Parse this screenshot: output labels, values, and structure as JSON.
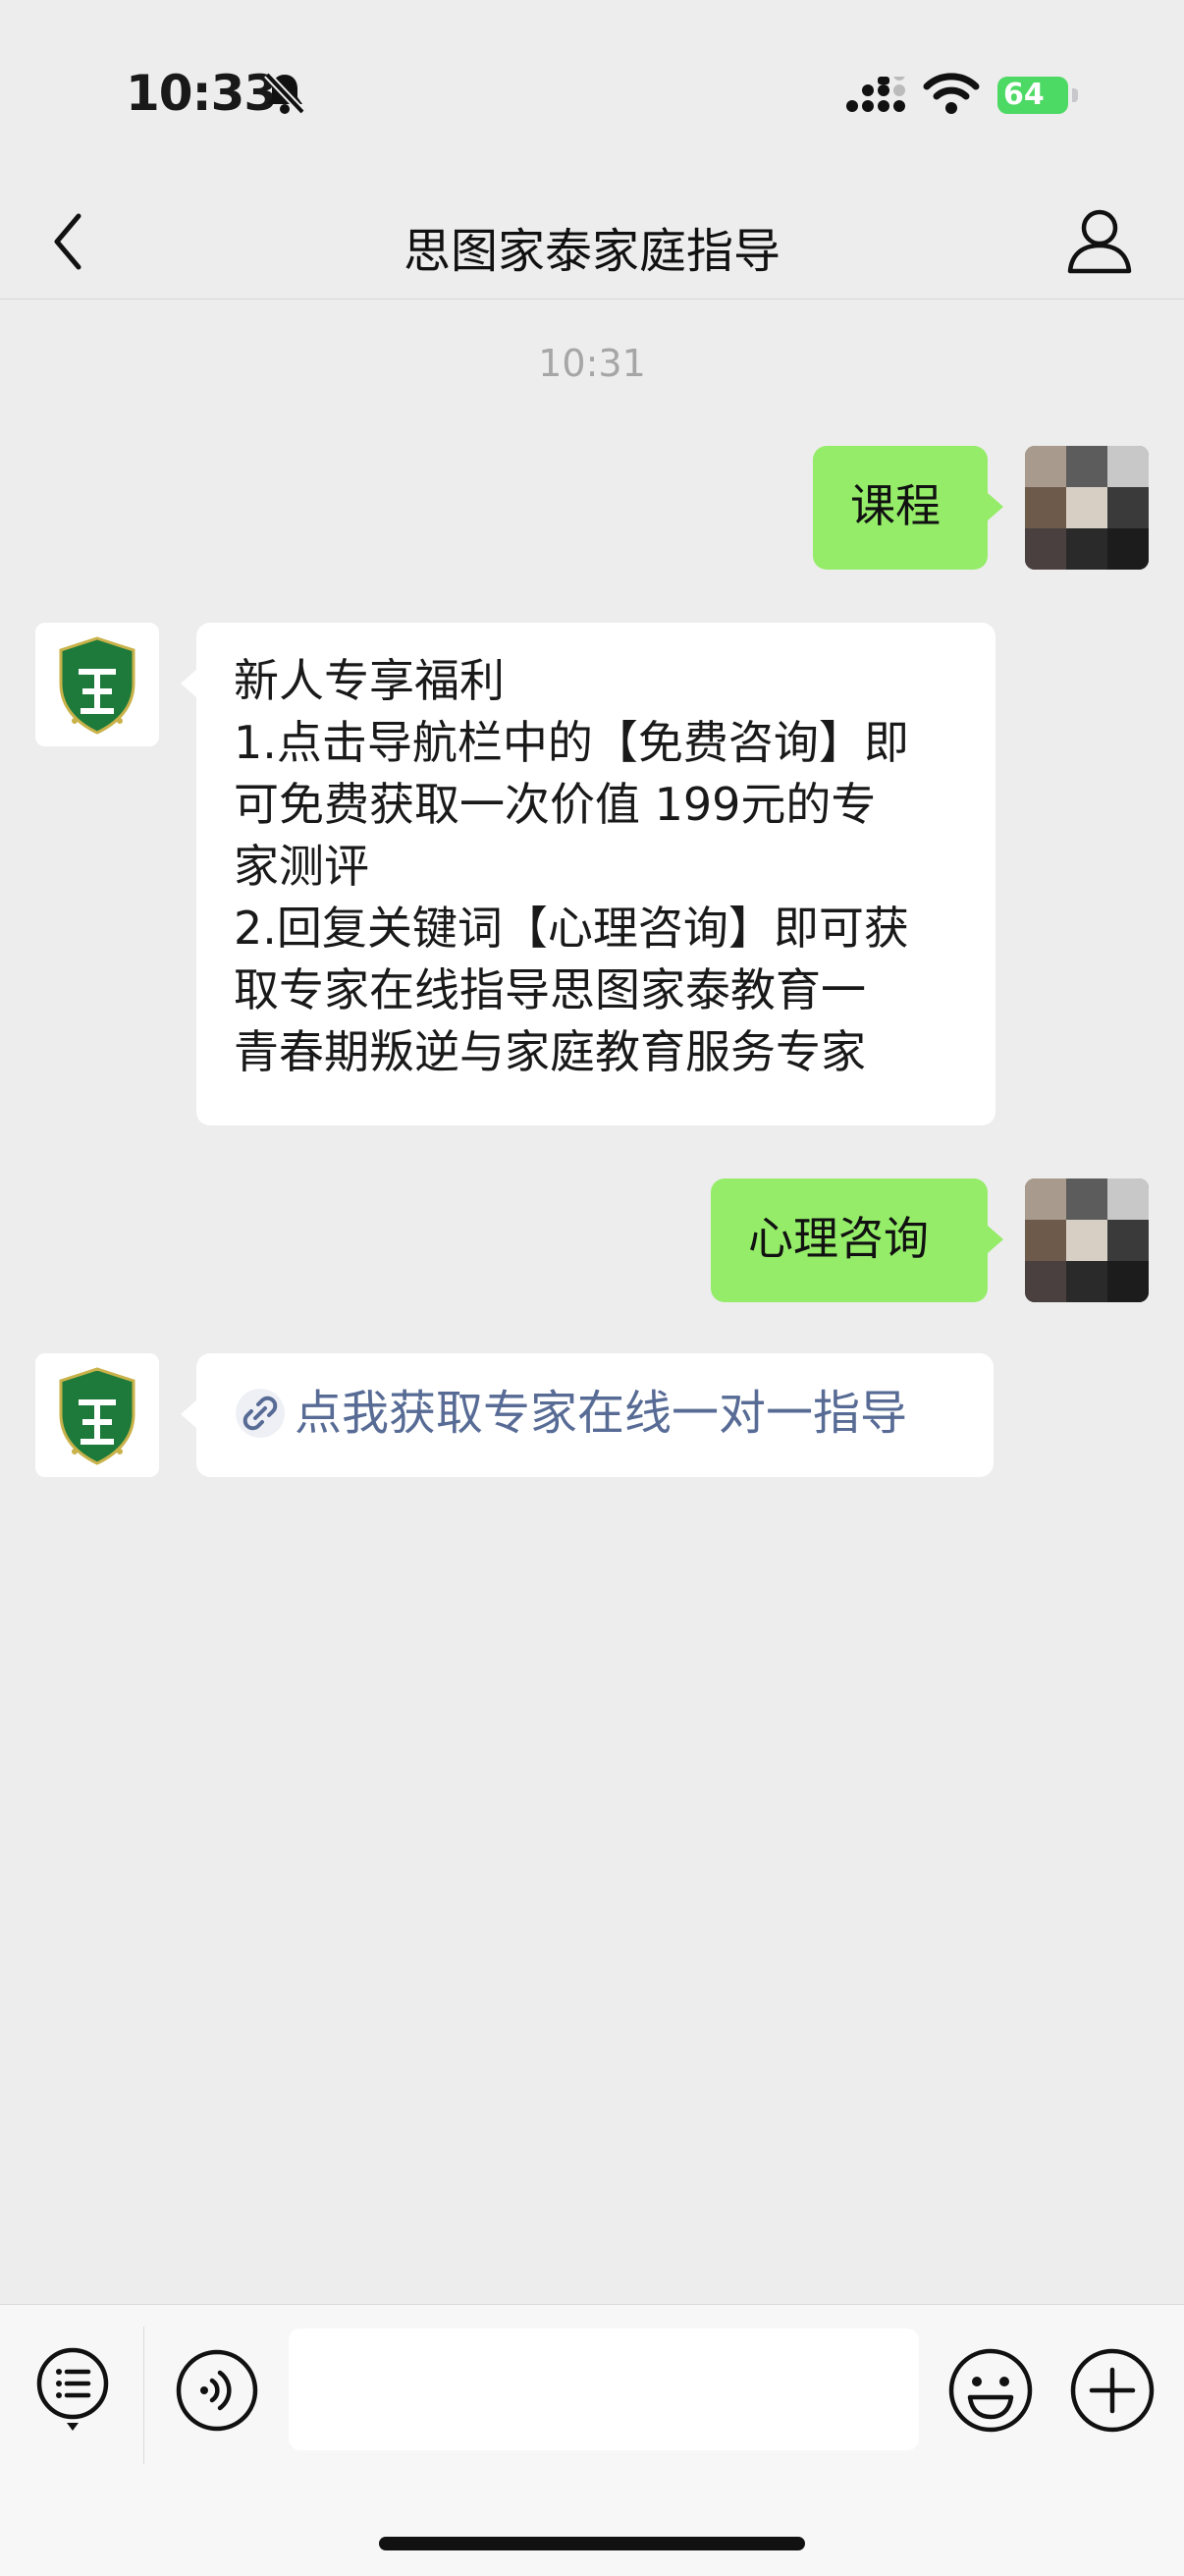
{
  "status_bar": {
    "time": "10:33",
    "battery": "64"
  },
  "nav": {
    "title": "思图家泰家庭指导"
  },
  "chat": {
    "timestamp": "10:31",
    "messages": [
      {
        "sender": "user",
        "text": "课程"
      },
      {
        "sender": "bot",
        "lines": [
          "新人专享福利",
          "1.点击导航栏中的【免费咨询】即",
          "可免费获取一次价值 199元的专",
          "家测评",
          "2.回复关键词【心理咨询】即可获",
          "取专家在线指导思图家泰教育一",
          "青春期叛逆与家庭教育服务专家"
        ]
      },
      {
        "sender": "user",
        "text": "心理咨询"
      },
      {
        "sender": "bot",
        "link_text": "点我获取专家在线一对一指导"
      }
    ]
  },
  "input": {
    "value": "",
    "placeholder": ""
  },
  "colors": {
    "bubble_green": "#95ec69",
    "link": "#576b95",
    "badge_green": "#1d7a3a"
  },
  "icons": [
    "bell-slash-icon",
    "cellular-signal-icon",
    "wifi-icon",
    "battery-icon",
    "back-chevron-icon",
    "profile-icon",
    "link-icon",
    "menu-list-icon",
    "voice-icon",
    "emoji-icon",
    "plus-icon"
  ]
}
